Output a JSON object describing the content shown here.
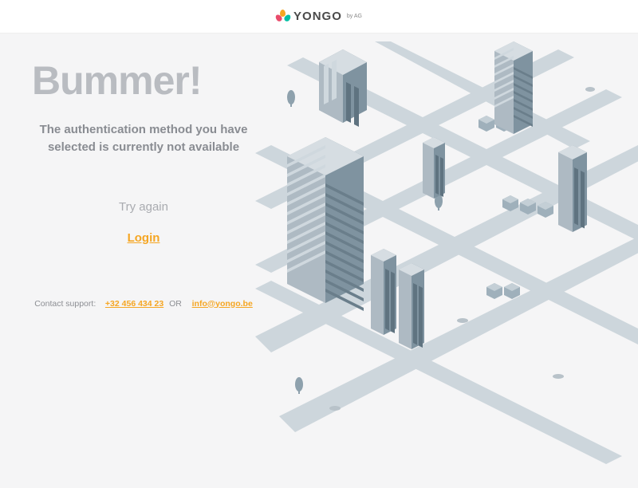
{
  "header": {
    "logo_text": "YONGO",
    "logo_by": "by AG"
  },
  "error": {
    "title": "Bummer!",
    "subtitle": "The authentication method you have selected is currently not available",
    "try_again_label": "Try again",
    "login_label": "Login"
  },
  "support": {
    "prefix": "Contact support:",
    "phone": "+32 456 434 23",
    "or": "OR",
    "email": "info@yongo.be"
  }
}
